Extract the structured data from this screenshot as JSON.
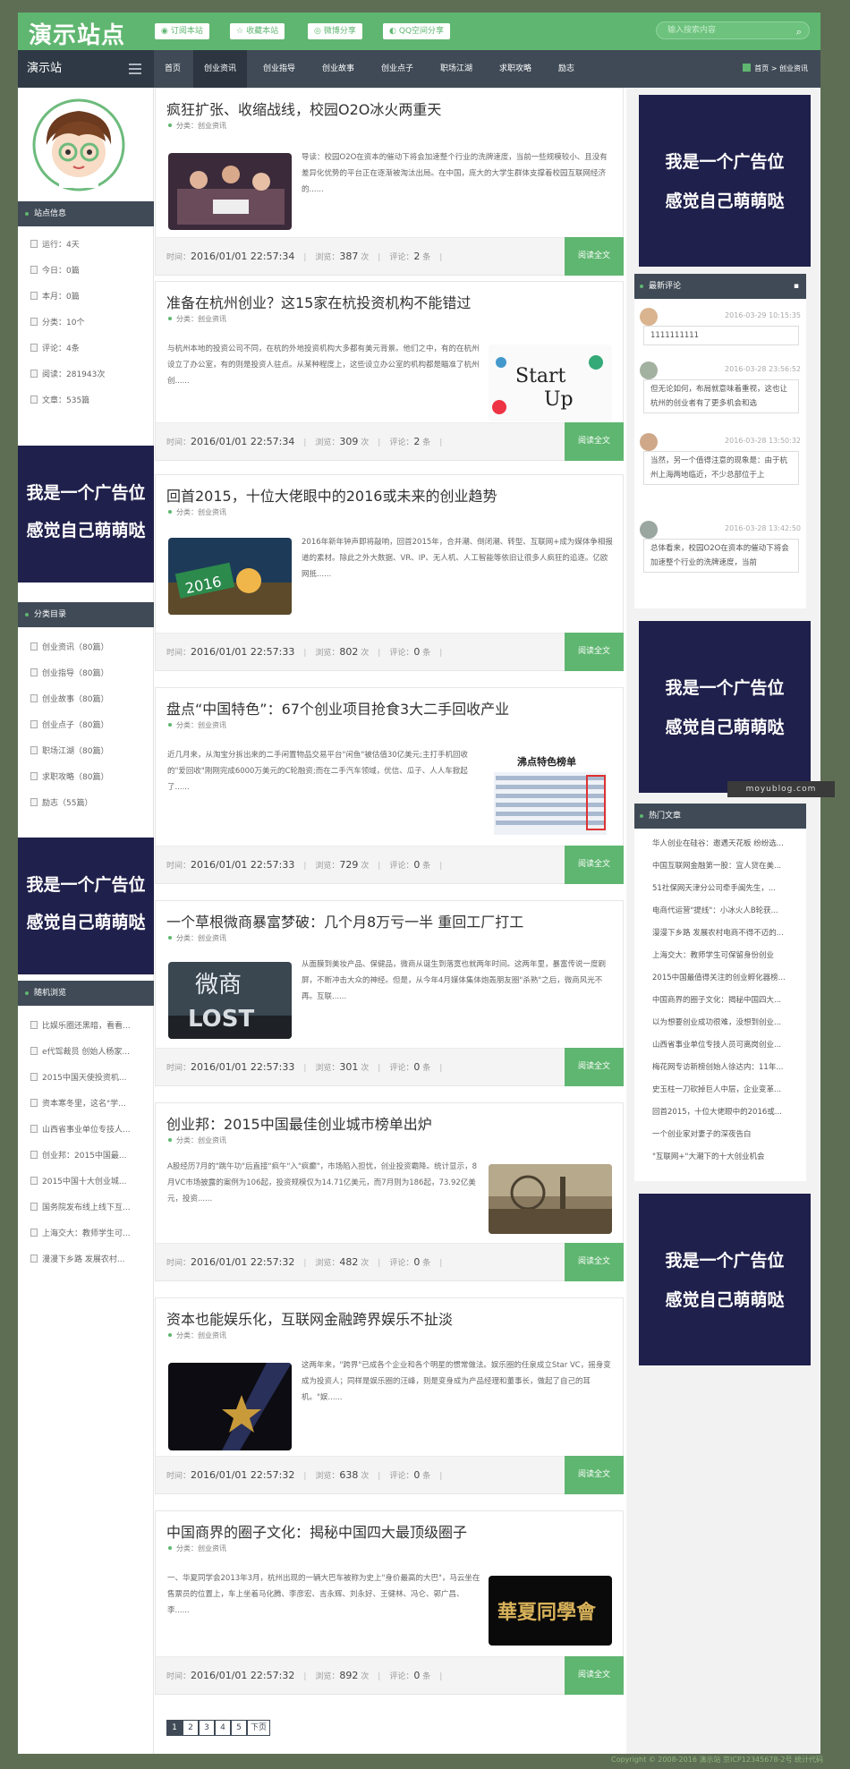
{
  "header": {
    "logo": "演示站点",
    "buttons": [
      {
        "label": "订阅本站",
        "icon": "rss-icon"
      },
      {
        "label": "收藏本站",
        "icon": "bookmark-icon"
      },
      {
        "label": "微博分享",
        "icon": "weibo-icon"
      },
      {
        "label": "QQ空间分享",
        "icon": "qq-icon"
      }
    ],
    "search_placeholder": "输入搜索内容"
  },
  "nav": {
    "brand": "演示站",
    "items": [
      "首页",
      "创业资讯",
      "创业指导",
      "创业故事",
      "创业点子",
      "职场江湖",
      "求职攻略",
      "励志"
    ],
    "active": "创业资讯",
    "breadcrumb": "首页 > 创业资讯"
  },
  "sidebar_left": {
    "site_info_title": "站点信息",
    "site_info": [
      "运行：4天",
      "今日：0篇",
      "本月：0篇",
      "分类：10个",
      "评论：4条",
      "阅读：281943次",
      "文章：535篇"
    ],
    "categories_title": "分类目录",
    "categories": [
      "创业资讯（80篇）",
      "创业指导（80篇）",
      "创业故事（80篇）",
      "创业点子（80篇）",
      "职场江湖（80篇）",
      "求职攻略（80篇）",
      "励志（55篇）"
    ],
    "random_title": "随机浏览",
    "random": [
      "比娱乐圈还黑暗，看看...",
      "e代驾裁员 创始人杨家...",
      "2015中国天使投资机...",
      "资本寒冬里，这名\"学...",
      "山西省事业单位专技人...",
      "创业邦：2015中国最...",
      "2015中国十大创业城...",
      "国务院发布线上线下互...",
      "上海交大：教师学生可...",
      "漫漫下乡路 发展农村..."
    ]
  },
  "ad": {
    "line1": "我是一个广告位",
    "line2": "感觉自己萌萌哒"
  },
  "posts": [
    {
      "title": "疯狂扩张、收缩战线，校园O2O冰火两重天",
      "category": "分类：创业资讯",
      "excerpt": "导读：校园O2O在资本的催动下将会加速整个行业的洗牌速度，当前一些规模较小、且没有差异化优势的平台正在逐渐被淘汰出局。在中国，庞大的大学生群体支撑着校园互联网经济的......",
      "time": "2016/01/01 22:57:34",
      "views": "387",
      "comments": "2"
    },
    {
      "title": "准备在杭州创业？这15家在杭投资机构不能错过",
      "category": "分类：创业资讯",
      "excerpt": "与杭州本地的投资公司不同，在杭的外地投资机构大多都有美元背景。他们之中，有的在杭州设立了办公室，有的则是投资人驻点。从某种程度上，这些设立办公室的机构都是瞄准了杭州创......",
      "time": "2016/01/01 22:57:34",
      "views": "309",
      "comments": "2"
    },
    {
      "title": "回首2015，十位大佬眼中的2016或未来的创业趋势",
      "category": "分类：创业资讯",
      "excerpt": "2016年新年钟声即将敲响，回首2015年，合并潮、倒闭潮、转型、互联网+成为媒体争相报道的素材。除此之外大数据、VR、IP、无人机、人工智能等依旧让很多人疯狂的追逐。亿欧网抵......",
      "time": "2016/01/01 22:57:33",
      "views": "802",
      "comments": "0"
    },
    {
      "title": "盘点“中国特色”：67个创业项目抢食3大二手回收产业",
      "category": "分类：创业资讯",
      "excerpt": "近几月来，从淘宝分拆出来的二手闲置物品交易平台\"闲鱼\"被估值30亿美元;主打手机回收的\"爱回收\"刚刚完成6000万美元的C轮融资;而在二手汽车领域，优信、瓜子、人人车掀起了......",
      "time": "2016/01/01 22:57:33",
      "views": "729",
      "comments": "0"
    },
    {
      "title": "一个草根微商暴富梦破：几个月8万亏一半 重回工厂打工",
      "category": "分类：创业资讯",
      "excerpt": "从面膜到美妆产品、保健品，微商从诞生到落寞也就两年时间。这两年里，暴富传说一度刷屏，不断冲击大众的神经。但是，从今年4月媒体集体炮轰朋友圈\"杀熟\"之后，微商风光不再。互联......",
      "time": "2016/01/01 22:57:33",
      "views": "301",
      "comments": "0"
    },
    {
      "title": "创业邦：2015中国最佳创业城市榜单出炉",
      "category": "分类：创业资讯",
      "excerpt": "A股经历7月的\"跳午功\"后直接\"疯午\"入\"疯癫\"，市场陷入担忧，创业投资霸降。统计显示，8月VC市场披露的案例为106起，投资规模仅为14.71亿美元，而7月则为186起，73.92亿美元，投资......",
      "time": "2016/01/01 22:57:32",
      "views": "482",
      "comments": "0"
    },
    {
      "title": "资本也能娱乐化，互联网金融跨界娱乐不扯淡",
      "category": "分类：创业资讯",
      "excerpt": "这两年来，\"跨界\"已成各个企业和各个明星的惯常做法。娱乐圈的任泉成立Star VC，摇身变成为投资人；同样是娱乐圈的汪峰，则是变身成为产品经理和董事长，做起了自己的耳机。\"娱......",
      "time": "2016/01/01 22:57:32",
      "views": "638",
      "comments": "0"
    },
    {
      "title": "中国商界的圈子文化：揭秘中国四大最顶级圈子",
      "category": "分类：创业资讯",
      "excerpt": "一、华夏同学会2013年3月，杭州出现的一辆大巴车被称为史上\"身价最高的大巴\"，马云坐在售票员的位置上，车上坐着马化腾、李彦宏、吉永辉、刘永好、王健林、冯仑、郭广昌、李......",
      "time": "2016/01/01 22:57:32",
      "views": "892",
      "comments": "0"
    }
  ],
  "labels": {
    "time": "时间：",
    "views": "浏览：",
    "times_unit": "次",
    "comments": "评论：",
    "comments_unit": "条",
    "read_more": "阅读全文"
  },
  "pager": [
    "1",
    "2",
    "3",
    "4",
    "5",
    "下页"
  ],
  "sidebar_right": {
    "comments_title": "最新评论",
    "comments": [
      {
        "date": "2016-03-29 10:15:35",
        "text": "1111111111"
      },
      {
        "date": "2016-03-28 23:56:52",
        "text": "但无论如何，布局就意味着重视，这也让杭州的创业者有了更多机会和选"
      },
      {
        "date": "2016-03-28 13:50:32",
        "text": "当然，另一个值得注意的现象是：由于杭州上海两地临近，不少总部位于上"
      },
      {
        "date": "2016-03-28 13:42:50",
        "text": "总体看来，校园O2O在资本的催动下将会加速整个行业的洗牌速度，当前"
      }
    ],
    "hot_title": "热门文章",
    "hot": [
      "华人创业在硅谷：邀遇天花板 纷纷选...",
      "中国互联网金融第一股：宜人贷在美...",
      "51社保网天津分公司牵手闽先生，...",
      "电商代运营\"提线\"：小冰火人B轮获...",
      "漫漫下乡路 发展农村电商不得不迈的...",
      "上海交大：教师学生可保留身份创业",
      "2015中国最值得关注的创业孵化器榜...",
      "中国商界的圈子文化：揭秘中国四大...",
      "以为想要创业成功很难，没想到创业...",
      "山西省事业单位专技人员可离岗创业...",
      "梅花网专访新榜创始人徐达内：11年...",
      "史玉柱一刀砍掉巨人中层，企业变革...",
      "回首2015，十位大佬眼中的2016或...",
      "一个创业家对妻子的深夜告白",
      "\"互联网+\"大潮下的十大创业机会"
    ]
  },
  "watermark": "moyublog.com",
  "footer": "Copyright © 2008-2016 演示站 京ICP12345678-2号  统计代码"
}
